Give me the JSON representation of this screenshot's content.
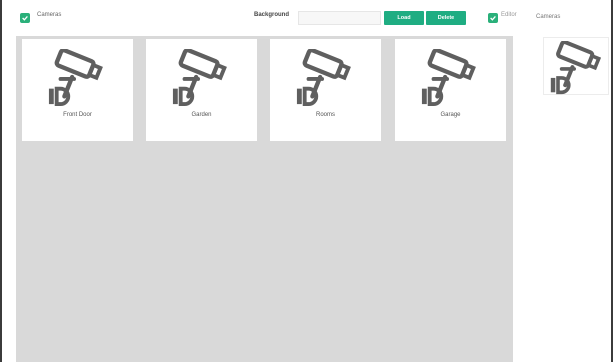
{
  "toolbar": {
    "cameras_label": "Cameras",
    "cameras_checked": true,
    "background_label": "Background",
    "background_value": "",
    "load_label": "Load",
    "delete_label": "Delete",
    "editor_label": "Editor",
    "editor_checked": true
  },
  "colors": {
    "accent": "#1fad82",
    "checkbox": "#2ab07a",
    "canvas": "#d9d9d9",
    "icon": "#5f5f5f"
  },
  "tiles": [
    {
      "label": "Front Door",
      "icon": "security-camera-icon"
    },
    {
      "label": "Garden",
      "icon": "security-camera-icon"
    },
    {
      "label": "Rooms",
      "icon": "security-camera-icon"
    },
    {
      "label": "Garage",
      "icon": "security-camera-icon"
    }
  ],
  "sidebar": {
    "title": "Cameras",
    "item_icon": "security-camera-icon"
  }
}
